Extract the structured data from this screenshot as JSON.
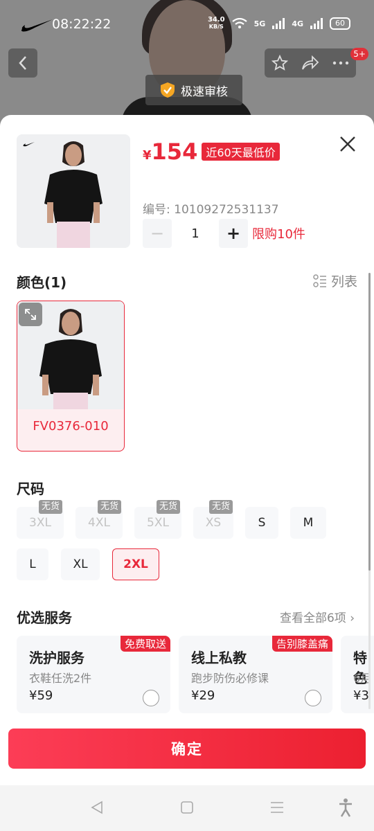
{
  "status_bar": {
    "time": "08:22:22",
    "net_speed_value": "34.0",
    "net_speed_unit": "KB/S",
    "net5g": "5G",
    "net4g": "4G",
    "battery": "60"
  },
  "header": {
    "notification_count": "5+",
    "review_badge": "极速审核"
  },
  "product": {
    "currency": "¥",
    "price": "154",
    "price_tag": "近60天最低价",
    "sku": "编号: 10109272531137",
    "quantity": "1",
    "minus": "−",
    "plus": "+",
    "purchase_limit": "限购10件"
  },
  "color_section": {
    "title": "颜色(1)",
    "list_toggle": "列表",
    "options": [
      {
        "code": "FV0376-010",
        "selected": true
      }
    ]
  },
  "size_section": {
    "title": "尺码",
    "sizes": [
      {
        "label": "3XL",
        "available": false,
        "soldout": "无货"
      },
      {
        "label": "4XL",
        "available": false,
        "soldout": "无货"
      },
      {
        "label": "5XL",
        "available": false,
        "soldout": "无货"
      },
      {
        "label": "XS",
        "available": false,
        "soldout": "无货"
      },
      {
        "label": "S",
        "available": true
      },
      {
        "label": "M",
        "available": true
      },
      {
        "label": "L",
        "available": true
      },
      {
        "label": "XL",
        "available": true
      },
      {
        "label": "2XL",
        "available": true,
        "selected": true
      }
    ]
  },
  "services": {
    "title": "优选服务",
    "see_all": "查看全部6项 ›",
    "items": [
      {
        "tag": "免费取送",
        "title": "洗护服务",
        "subtitle": "衣鞋任洗2件",
        "price": "¥59"
      },
      {
        "tag": "告别膝盖痛",
        "title": "线上私教",
        "subtitle": "跑步防伤必修课",
        "price": "¥29"
      },
      {
        "tag": "",
        "title": "特色",
        "subtitle": "6月",
        "price": "¥3"
      }
    ]
  },
  "confirm": {
    "label": "确定"
  },
  "colors": {
    "accent": "#e8283a",
    "selected_bg": "#fdeef0"
  }
}
